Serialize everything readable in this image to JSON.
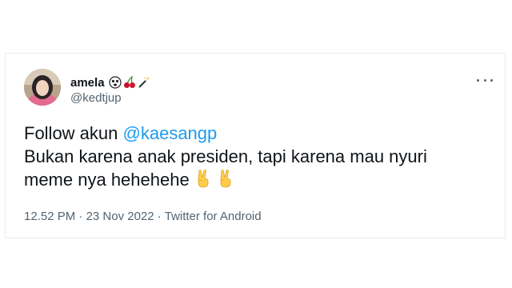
{
  "tweet": {
    "display_name": "amela",
    "handle": "@kedtjup",
    "name_emojis": [
      "ghost-face-emoji",
      "cherries-emoji",
      "magic-wand-emoji"
    ],
    "text_line1_prefix": "Follow akun ",
    "mention": "@kaesangp",
    "text_line2": "Bukan karena anak presiden, tapi karena mau nyuri",
    "text_line3": "meme nya hehehehe",
    "text_emojis": [
      "victory-hand-emoji",
      "victory-hand-emoji"
    ],
    "time": "12.52 PM",
    "separator": " · ",
    "date": "23 Nov 2022",
    "source": "Twitter for Android",
    "more_icon": "more-horizontal-icon"
  },
  "colors": {
    "mention": "#1d9bf0",
    "text": "#0f1419",
    "secondary": "#536471",
    "border": "#e6ecf0"
  }
}
